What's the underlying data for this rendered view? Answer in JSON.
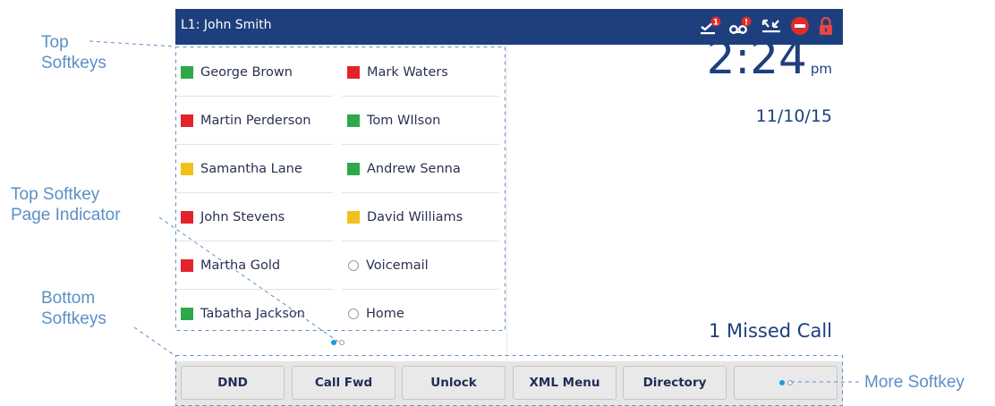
{
  "callouts": {
    "top_softkeys": [
      "Top",
      "Softkeys"
    ],
    "page_indicator": [
      "Top Softkey",
      "Page Indicator"
    ],
    "bottom_softkeys": [
      "Bottom",
      "Softkeys"
    ],
    "more_softkey": "More Softkey"
  },
  "title_bar": {
    "line": "L1: John Smith",
    "icons": [
      {
        "name": "missed-calls-icon",
        "badge": "1"
      },
      {
        "name": "voicemail-icon",
        "badge": "!"
      },
      {
        "name": "call-forward-icon"
      },
      {
        "name": "dnd-icon"
      },
      {
        "name": "lock-icon"
      }
    ],
    "colors": {
      "bar": "#1e3f7d",
      "badge": "#e02b2b",
      "dnd": "#e02b2b",
      "lock": "#e84545"
    }
  },
  "top_softkeys": {
    "column1": [
      {
        "label": "George Brown",
        "status": "green"
      },
      {
        "label": "Martin Perderson",
        "status": "red"
      },
      {
        "label": "Samantha Lane",
        "status": "yellow"
      },
      {
        "label": "John Stevens",
        "status": "red"
      },
      {
        "label": "Martha Gold",
        "status": "red"
      },
      {
        "label": "Tabatha Jackson",
        "status": "green"
      }
    ],
    "column2": [
      {
        "label": "Mark Waters",
        "status": "red"
      },
      {
        "label": "Tom WIlson",
        "status": "green"
      },
      {
        "label": "Andrew Senna",
        "status": "green"
      },
      {
        "label": "David Williams",
        "status": "yellow"
      },
      {
        "label": "Voicemail",
        "status": "none"
      },
      {
        "label": "Home",
        "status": "none"
      }
    ],
    "status_colors": {
      "green": "#2ea84a",
      "red": "#e5222b",
      "yellow": "#f2c01b"
    }
  },
  "clock": {
    "time": "2:24",
    "ampm": "pm",
    "date": "11/10/15"
  },
  "missed_calls": "1  Missed Call",
  "page_indicator": {
    "pages": 2,
    "current": 1,
    "active_color": "#1a9be0"
  },
  "bottom_softkeys": [
    {
      "label": "DND",
      "active": true
    },
    {
      "label": "Call Fwd",
      "active": true
    },
    {
      "label": "Unlock",
      "active": false
    },
    {
      "label": "XML Menu",
      "active": false
    },
    {
      "label": "Directory",
      "active": false
    }
  ],
  "more_softkey": {
    "pages": 2,
    "current": 1
  }
}
